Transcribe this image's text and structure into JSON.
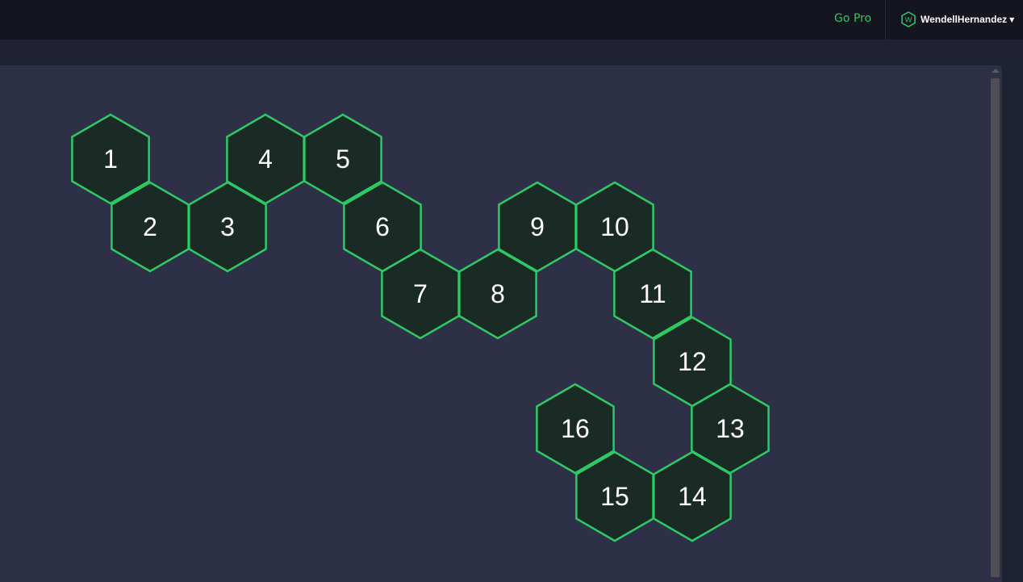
{
  "header": {
    "go_pro_label": "Go Pro",
    "username": "WendellHernandez",
    "avatar_letter": "W",
    "avatar_icon": "hexagon-avatar-icon",
    "caret_icon": "caret-down-icon"
  },
  "colors": {
    "accent": "#2ec866",
    "hex_fill": "#1a2a24",
    "panel_bg": "#2e3048",
    "page_bg": "#1f2233",
    "topbar_bg": "#14151f"
  },
  "hex_cells": [
    {
      "label": "1"
    },
    {
      "label": "2"
    },
    {
      "label": "3"
    },
    {
      "label": "4"
    },
    {
      "label": "5"
    },
    {
      "label": "6"
    },
    {
      "label": "7"
    },
    {
      "label": "8"
    },
    {
      "label": "9"
    },
    {
      "label": "10"
    },
    {
      "label": "11"
    },
    {
      "label": "12"
    },
    {
      "label": "13"
    },
    {
      "label": "14"
    },
    {
      "label": "15"
    },
    {
      "label": "16"
    }
  ]
}
